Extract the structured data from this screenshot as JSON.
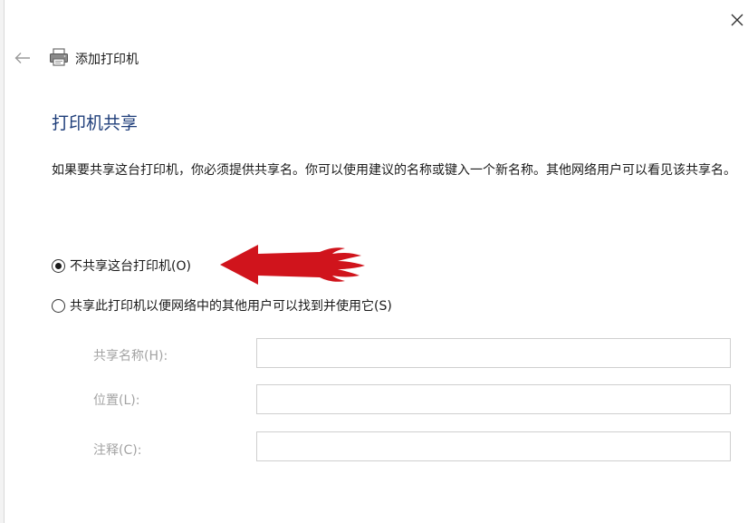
{
  "window": {
    "title": "添加打印机",
    "close_icon": "close-icon",
    "back_icon": "back-arrow-icon",
    "printer_icon": "printer-icon"
  },
  "page": {
    "heading": "打印机共享",
    "description": "如果要共享这台打印机，你必须提供共享名。你可以使用建议的名称或键入一个新名称。其他网络用户可以看见该共享名。"
  },
  "options": [
    {
      "label": "不共享这台打印机(O)",
      "selected": true
    },
    {
      "label": "共享此打印机以便网络中的其他用户可以找到并使用它(S)",
      "selected": false
    }
  ],
  "fields": {
    "share_name": {
      "label": "共享名称(H):",
      "value": ""
    },
    "location": {
      "label": "位置(L):",
      "value": ""
    },
    "comment": {
      "label": "注释(C):",
      "value": ""
    }
  },
  "colors": {
    "heading": "#1f3e7a",
    "disabled_label": "#a3a3a3",
    "annotation_arrow": "#d0141c"
  }
}
